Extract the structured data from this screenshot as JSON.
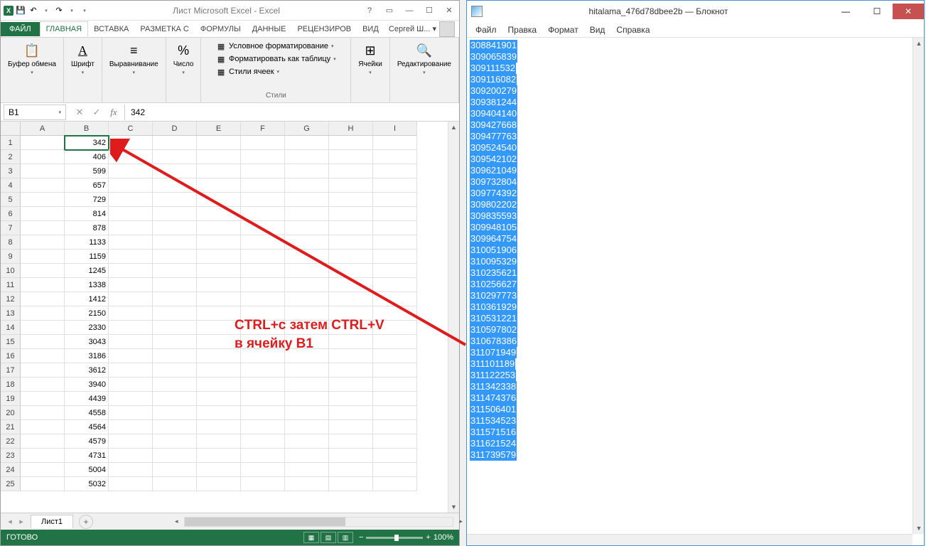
{
  "excel": {
    "title": "Лист Microsoft Excel - Excel",
    "tabs": {
      "file": "ФАЙЛ",
      "home": "ГЛАВНАЯ",
      "insert": "ВСТАВКА",
      "layout": "РАЗМЕТКА С",
      "formulas": "ФОРМУЛЫ",
      "data": "ДАННЫЕ",
      "review": "РЕЦЕНЗИРОВ",
      "view": "ВИД"
    },
    "user": "Сергей Ш... ▾",
    "ribbon": {
      "clipboard": {
        "label": "Буфер\nобмена"
      },
      "font": {
        "label": "Шрифт"
      },
      "alignment": {
        "label": "Выравнивание"
      },
      "number": {
        "label": "Число"
      },
      "styles": {
        "label": "Стили",
        "conditional": "Условное форматирование",
        "format_table": "Форматировать как таблицу",
        "cell_styles": "Стили ячеек"
      },
      "cells": {
        "label": "Ячейки"
      },
      "editing": {
        "label": "Редактирование"
      }
    },
    "name_box": "B1",
    "formula_value": "342",
    "columns": [
      "A",
      "B",
      "C",
      "D",
      "E",
      "F",
      "G",
      "H",
      "I"
    ],
    "rows": [
      {
        "n": "1",
        "b": "342"
      },
      {
        "n": "2",
        "b": "406"
      },
      {
        "n": "3",
        "b": "599"
      },
      {
        "n": "4",
        "b": "657"
      },
      {
        "n": "5",
        "b": "729"
      },
      {
        "n": "6",
        "b": "814"
      },
      {
        "n": "7",
        "b": "878"
      },
      {
        "n": "8",
        "b": "1133"
      },
      {
        "n": "9",
        "b": "1159"
      },
      {
        "n": "10",
        "b": "1245"
      },
      {
        "n": "11",
        "b": "1338"
      },
      {
        "n": "12",
        "b": "1412"
      },
      {
        "n": "13",
        "b": "2150"
      },
      {
        "n": "14",
        "b": "2330"
      },
      {
        "n": "15",
        "b": "3043"
      },
      {
        "n": "16",
        "b": "3186"
      },
      {
        "n": "17",
        "b": "3612"
      },
      {
        "n": "18",
        "b": "3940"
      },
      {
        "n": "19",
        "b": "4439"
      },
      {
        "n": "20",
        "b": "4558"
      },
      {
        "n": "21",
        "b": "4564"
      },
      {
        "n": "22",
        "b": "4579"
      },
      {
        "n": "23",
        "b": "4731"
      },
      {
        "n": "24",
        "b": "5004"
      },
      {
        "n": "25",
        "b": "5032"
      }
    ],
    "sheet": "Лист1",
    "status": "ГОТОВО",
    "zoom": "100%"
  },
  "annotation": {
    "line1": "CTRL+c  затем CTRL+V",
    "line2": "в ячейку B1"
  },
  "notepad": {
    "title": "hitalama_476d78dbee2b — Блокнот",
    "menu": {
      "file": "Файл",
      "edit": "Правка",
      "format": "Формат",
      "view": "Вид",
      "help": "Справка"
    },
    "lines": [
      "308841901",
      "309065839",
      "309111532",
      "309116082",
      "309200279",
      "309381244",
      "309404140",
      "309427668",
      "309477763",
      "309524540",
      "309542102",
      "309621049",
      "309732804",
      "309774392",
      "309802202",
      "309835593",
      "309948105",
      "309964754",
      "310051906",
      "310095329",
      "310235621",
      "310256627",
      "310297773",
      "310361929",
      "310531221",
      "310597802",
      "310678386",
      "311071949",
      "311101189",
      "311122253",
      "311342338",
      "311474376",
      "311506401",
      "311534523",
      "311571516",
      "311621524",
      "311739579"
    ]
  }
}
